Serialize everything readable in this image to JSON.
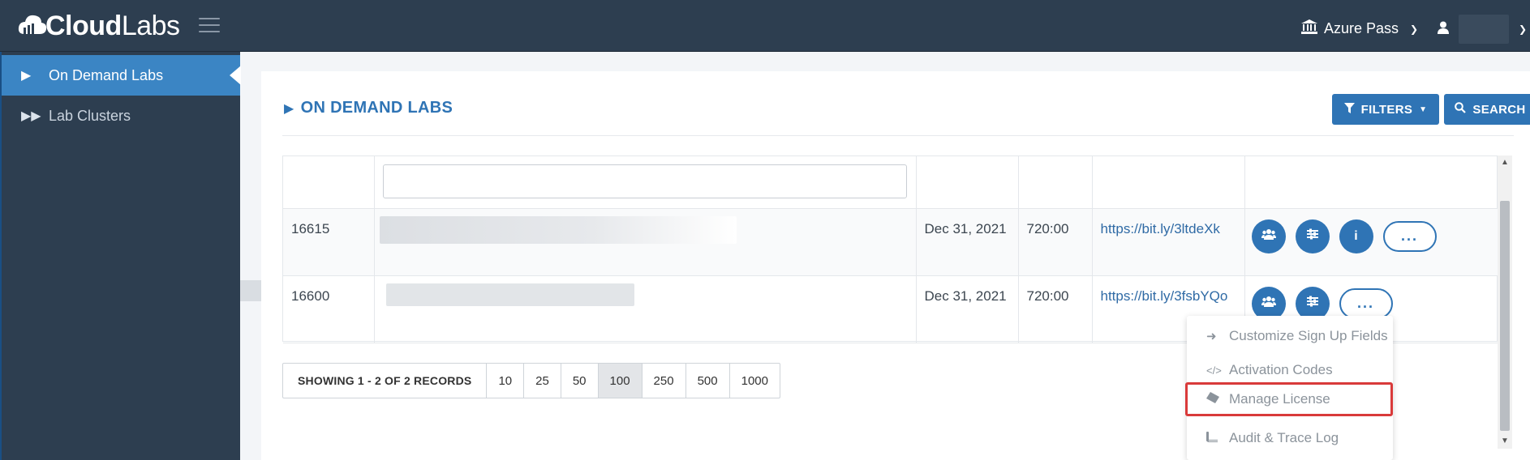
{
  "brand": {
    "logo_text_bold": "Cloud",
    "logo_text_light": "Labs"
  },
  "header": {
    "subscription_label": "Azure Pass"
  },
  "sidebar": {
    "items": [
      {
        "label": "On Demand Labs",
        "icon": "play-icon",
        "active": true
      },
      {
        "label": "Lab Clusters",
        "icon": "fast-forward-icon",
        "active": false
      }
    ]
  },
  "main": {
    "title": "ON DEMAND LABS",
    "filters_label": "FILTERS",
    "search_label": "SEARCH",
    "rows": [
      {
        "id": "16615",
        "date": "Dec 31, 2021",
        "duration": "720:00",
        "link": "https://bit.ly/3ltdeXk"
      },
      {
        "id": "16600",
        "date": "Dec 31, 2021",
        "duration": "720:00",
        "link": "https://bit.ly/3fsbYQo"
      }
    ],
    "more_label": "..."
  },
  "pager": {
    "summary": "SHOWING 1 - 2 OF 2 RECORDS",
    "sizes": [
      "10",
      "25",
      "50",
      "100",
      "250",
      "500",
      "1000"
    ],
    "active_size": "100"
  },
  "dropdown": {
    "items": [
      {
        "label": "Customize Sign Up Fields",
        "icon": "sign-in-icon"
      },
      {
        "label": "Activation Codes",
        "icon": "code-icon"
      },
      {
        "label": "Manage License",
        "icon": "ticket-icon",
        "highlighted": true
      },
      {
        "label": "Audit & Trace Log",
        "icon": "book-icon"
      }
    ]
  },
  "colors": {
    "topbar": "#2d3e50",
    "accent": "#2f74b5",
    "active_sidebar": "#3b85c4",
    "highlight_border": "#d93a3a"
  }
}
